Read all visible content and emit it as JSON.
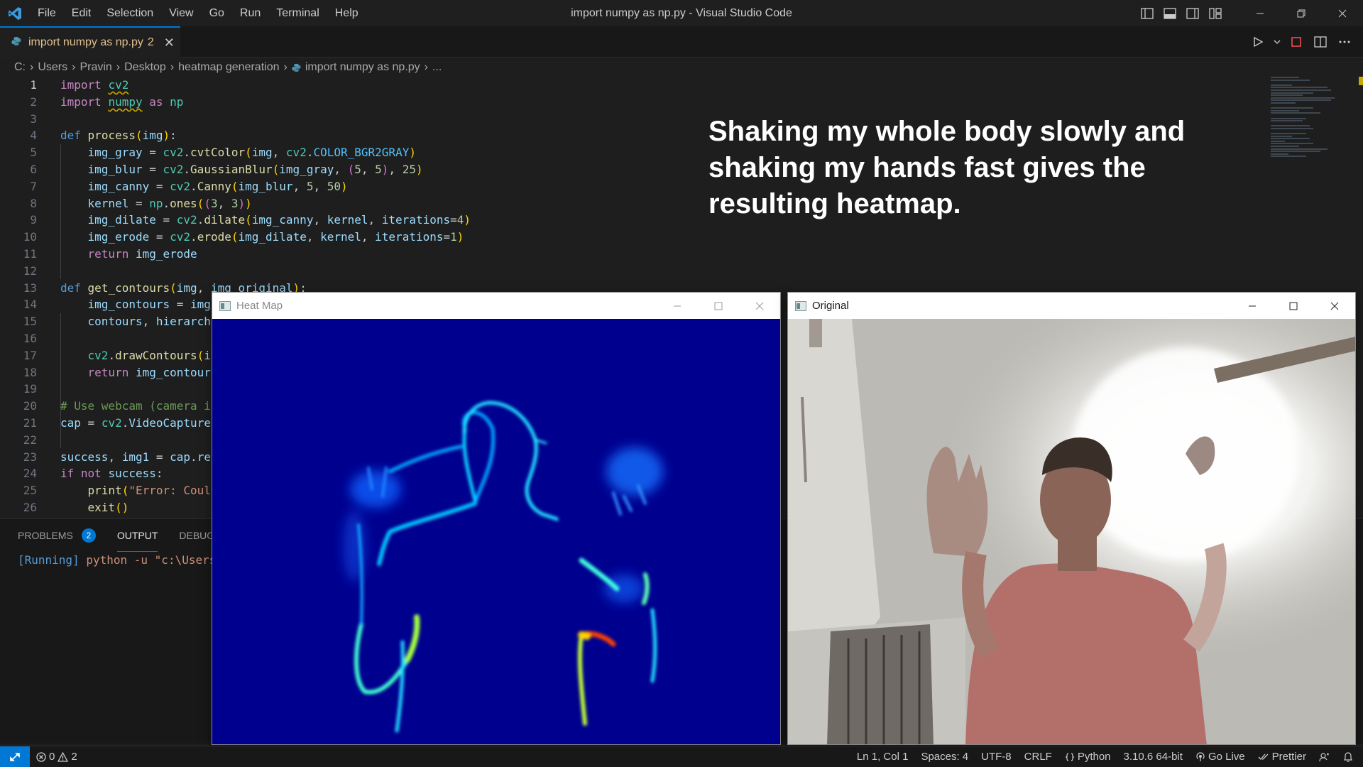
{
  "menu": [
    "File",
    "Edit",
    "Selection",
    "View",
    "Go",
    "Run",
    "Terminal",
    "Help"
  ],
  "window_title": "import numpy as np.py - Visual Studio Code",
  "tab": {
    "label": "import numpy as np.py",
    "badge": "2"
  },
  "breadcrumb": [
    "C:",
    "Users",
    "Pravin",
    "Desktop",
    "heatmap generation",
    "import numpy as np.py",
    "..."
  ],
  "editor": {
    "active_line": 1,
    "line_numbers": [
      "1",
      "2",
      "3",
      "4",
      "5",
      "6",
      "7",
      "8",
      "9",
      "10",
      "11",
      "12",
      "13",
      "14",
      "15",
      "16",
      "17",
      "18",
      "19",
      "20",
      "21",
      "22",
      "23",
      "24",
      "25",
      "26"
    ],
    "code_lines": [
      "import cv2",
      "import numpy as np",
      "",
      "def process(img):",
      "    img_gray = cv2.cvtColor(img, cv2.COLOR_BGR2GRAY)",
      "    img_blur = cv2.GaussianBlur(img_gray, (5, 5), 25)",
      "    img_canny = cv2.Canny(img_blur, 5, 50)",
      "    kernel = np.ones((3, 3))",
      "    img_dilate = cv2.dilate(img_canny, kernel, iterations=4)",
      "    img_erode = cv2.erode(img_dilate, kernel, iterations=1)",
      "    return img_erode",
      "",
      "def get_contours(img, img_original):",
      "    img_contours = img",
      "    contours, hierarch",
      "",
      "    cv2.drawContours(i",
      "    return img_contour",
      "",
      "# Use webcam (camera i",
      "cap = cv2.VideoCapture",
      "",
      "success, img1 = cap.re",
      "if not success:",
      "    print(\"Error: Coul",
      "    exit()"
    ]
  },
  "overlay_caption": "Shaking my whole body slowly and shaking my hands fast gives the resulting heatmap.",
  "panel": {
    "tabs": [
      "PROBLEMS",
      "OUTPUT",
      "DEBUG CO"
    ],
    "problems_count": "2",
    "active_tab": "OUTPUT",
    "output_running": "[Running]",
    "output_command": "python -u \"c:\\Users"
  },
  "windows": {
    "heatmap": {
      "title": "Heat Map"
    },
    "original": {
      "title": "Original"
    }
  },
  "statusbar": {
    "errors": "0",
    "warnings": "2",
    "position": "Ln 1, Col 1",
    "spaces": "Spaces: 4",
    "encoding": "UTF-8",
    "eol": "CRLF",
    "language": "Python",
    "interpreter": "3.10.6 64-bit",
    "golive": "Go Live",
    "prettier": "Prettier"
  },
  "colors": {
    "accent": "#0078d4",
    "tab_modified": "#e2c08d",
    "heatmap_bg": "#00008f"
  }
}
